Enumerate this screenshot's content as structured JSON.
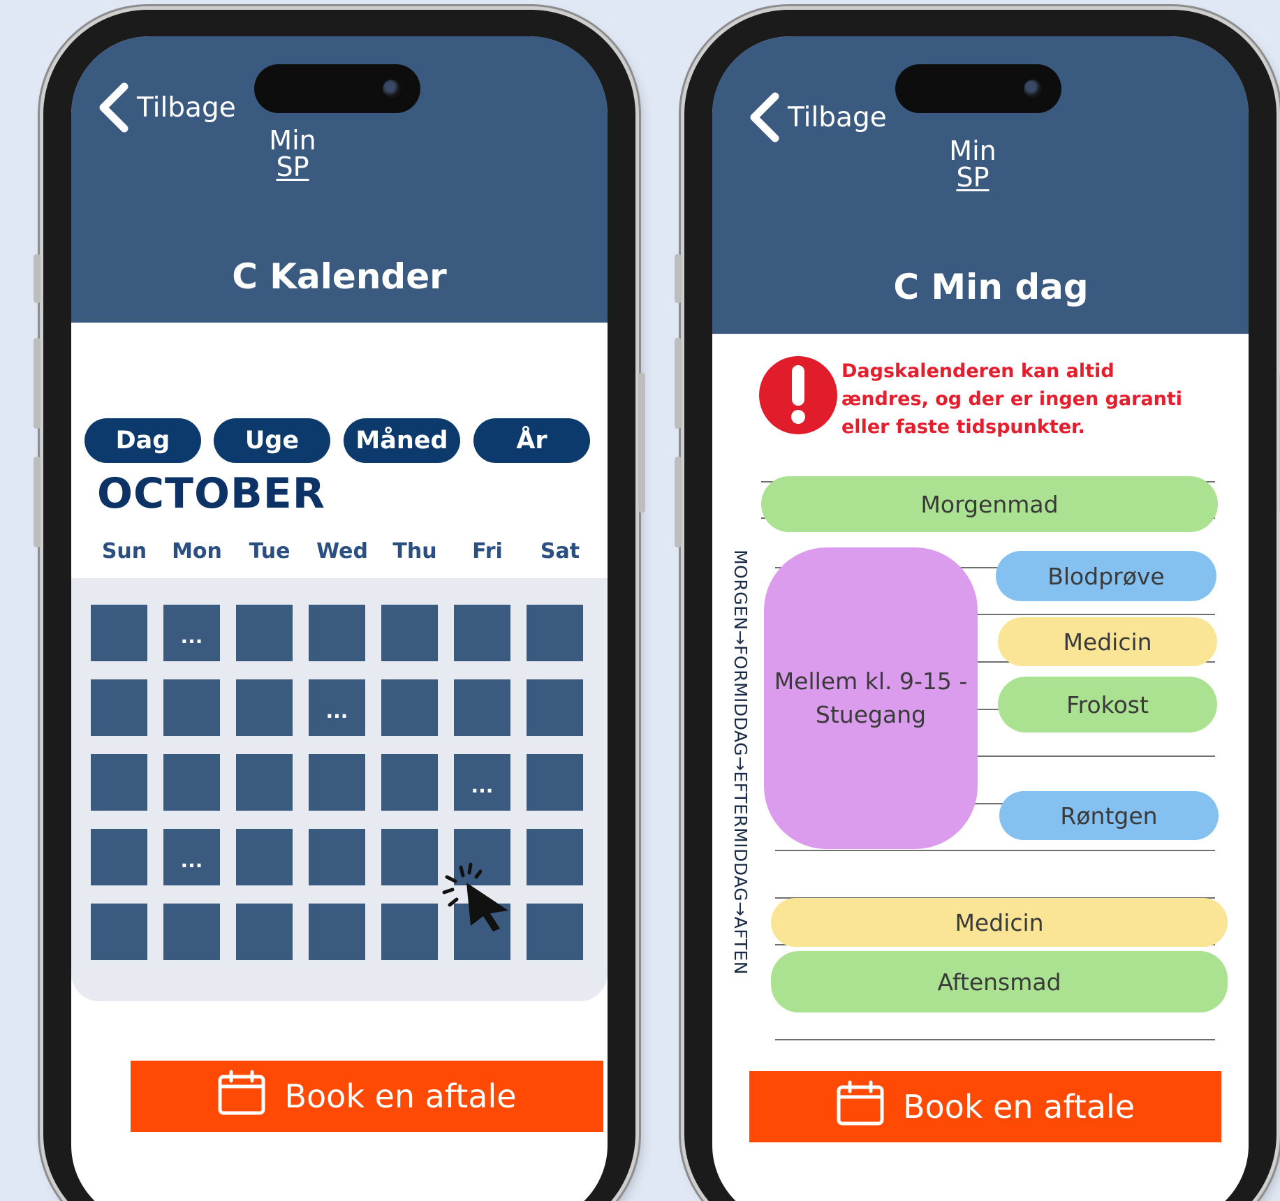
{
  "colors": {
    "background": "#dfe8f4",
    "header": "#3b5a80",
    "tab": "#0c3a6c",
    "month": "#0c3266",
    "cell": "#3b5a80",
    "book_button": "#ff4a06",
    "warning": "#e51e2e",
    "event_green": "#abe292",
    "event_blue": "#84c1f1",
    "event_yellow": "#fae596",
    "event_purple": "#dc9ced"
  },
  "left_screen": {
    "back_label": "Tilbage",
    "logo_line1": "Min",
    "logo_line2": "SP",
    "title": "C  Kalender",
    "view_tabs": [
      "Dag",
      "Uge",
      "Måned",
      "År"
    ],
    "month": "OCTOBER",
    "weekdays": [
      "Sun",
      "Mon",
      "Tue",
      "Wed",
      "Thu",
      "Fri",
      "Sat"
    ],
    "calendar_rows": [
      [
        "",
        "...",
        "",
        "",
        "",
        "",
        ""
      ],
      [
        "",
        "",
        "",
        "...",
        "",
        "",
        ""
      ],
      [
        "",
        "",
        "",
        "",
        "",
        "...",
        ""
      ],
      [
        "",
        "...",
        "",
        "",
        "",
        "",
        ""
      ],
      [
        "",
        "",
        "",
        "",
        "",
        "",
        ""
      ]
    ],
    "book_label": "Book en aftale",
    "icons": [
      "chevron-left-icon",
      "calendar-icon",
      "click-cursor-icon"
    ]
  },
  "right_screen": {
    "back_label": "Tilbage",
    "logo_line1": "Min",
    "logo_line2": "SP",
    "title": "C  Min dag",
    "notice": "Dagskalenderen kan altid ændres, og der er ingen garanti eller faste tidspunkter.",
    "time_axis": "MORGEN→FORMIDDAG→EFTERMIDDAG→AFTEN",
    "events": {
      "morgenmad": "Morgenmad",
      "blodprove": "Blodprøve",
      "medicin_morning": "Medicin",
      "stuegang": "Mellem kl. 9-15 - Stuegang",
      "frokost": "Frokost",
      "rontgen": "Røntgen",
      "medicin_evening": "Medicin",
      "aftensmad": "Aftensmad"
    },
    "book_label": "Book en aftale",
    "icons": [
      "chevron-left-icon",
      "exclamation-icon",
      "calendar-icon"
    ]
  }
}
